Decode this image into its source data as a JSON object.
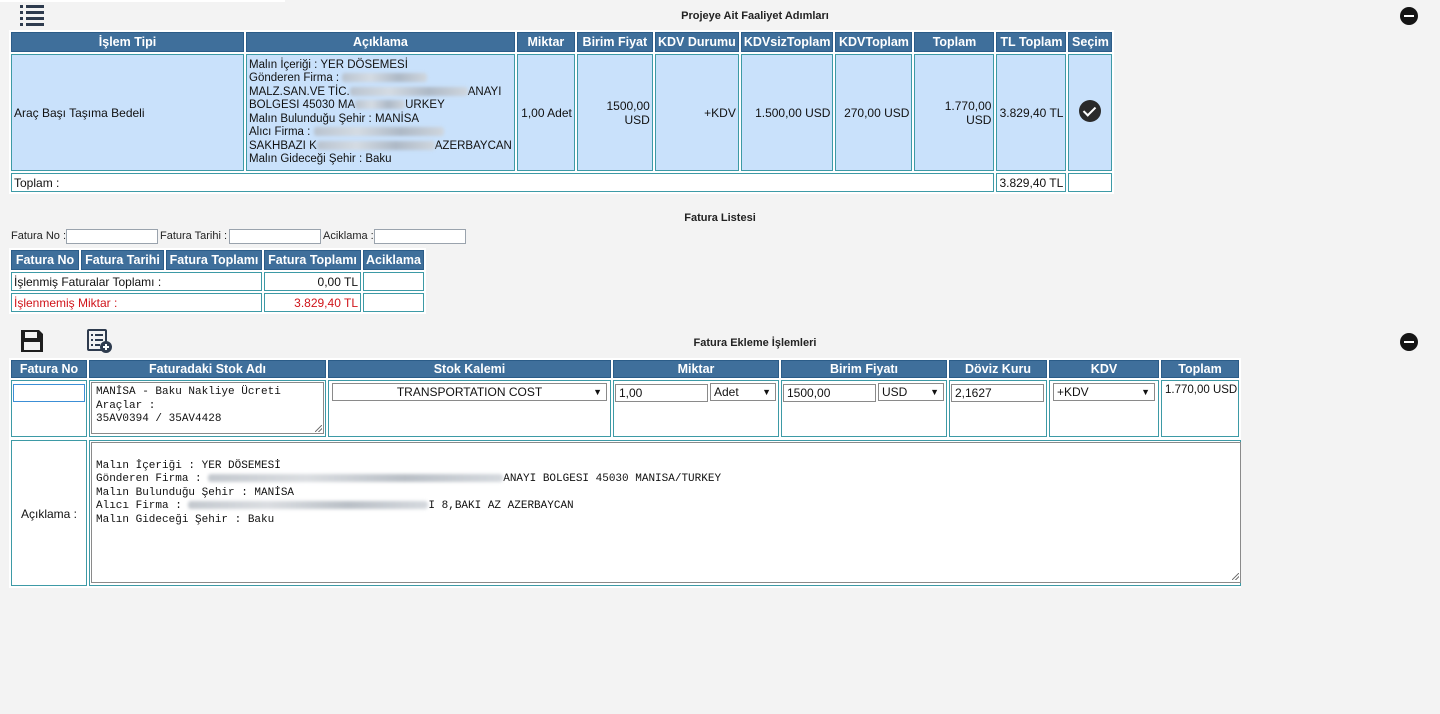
{
  "activity": {
    "title": "Projeye Ait Faaliyet Adımları",
    "headers": [
      "İşlem Tipi",
      "Açıklama",
      "Miktar",
      "Birim Fiyat",
      "KDV Durumu",
      "KDVsizToplam",
      "KDVToplam",
      "Toplam",
      "TL Toplam",
      "Seçim"
    ],
    "row": {
      "islem_tipi": "Araç Başı Taşıma Bedeli",
      "aciklama_lines": [
        "Malın İçeriği : YER DÖSEMESİ",
        "Gönderen Firma :",
        "MALZ.SAN.VE TİC.",
        "BOLGESI 45030 MA",
        "Malın Bulunduğu Şehir : MANİSA",
        "Alıcı Firma :",
        "SAKHBAZI K",
        "Malın Gideceği Şehir : Baku"
      ],
      "aciklama_tail_3": "ANAYI",
      "aciklama_tail_4": "URKEY",
      "aciklama_tail_7": "AZERBAYCAN",
      "miktar": "1,00 Adet",
      "birim_fiyat": "1500,00 USD",
      "kdv_durumu": "+KDV",
      "kdvsiz_toplam": "1.500,00 USD",
      "kdv_toplam": "270,00 USD",
      "toplam": "1.770,00 USD",
      "tl_toplam": "3.829,40 TL"
    },
    "total_label": "Toplam :",
    "total_value": "3.829,40 TL"
  },
  "invoice_list": {
    "title": "Fatura Listesi",
    "filters": {
      "fatura_no": "Fatura No :",
      "fatura_tarihi": "Fatura Tarihi :",
      "aciklama": "Aciklama :"
    },
    "headers": [
      "Fatura No",
      "Fatura Tarihi",
      "Fatura Toplamı",
      "Fatura Toplamı",
      "Aciklama"
    ],
    "processed_label": "İşlenmiş Faturalar Toplamı :",
    "processed_value": "0,00 TL",
    "unprocessed_label": "İşlenmemiş Miktar :",
    "unprocessed_value": "3.829,40 TL"
  },
  "invoice_add": {
    "title": "Fatura Ekleme İşlemleri",
    "headers": [
      "Fatura No",
      "Faturadaki Stok Adı",
      "Stok Kalemi",
      "Miktar",
      "Birim Fiyatı",
      "Döviz Kuru",
      "KDV",
      "Toplam"
    ],
    "fatura_no": "",
    "stok_adi": "MANİSA - Baku Nakliye Ücreti\nAraçlar :\n35AV0394 / 35AV4428",
    "stok_kalemi": "TRANSPORTATION COST",
    "miktar": "1,00",
    "birim": "Adet",
    "birim_fiyati": "1500,00",
    "doviz": "USD",
    "doviz_kuru": "2,1627",
    "kdv": "+KDV",
    "toplam": "1.770,00 USD",
    "aciklama_label": "Açıklama :",
    "aciklama_l1": "Malın İçeriği : YER DÖSEMESİ",
    "aciklama_l2a": "Gönderen Firma : ",
    "aciklama_l2b": "ANAYI BOLGESI 45030 MANISA/TURKEY",
    "aciklama_l3": "Malın Bulunduğu Şehir : MANİSA",
    "aciklama_l4a": "Alıcı Firma : ",
    "aciklama_l4b": "I 8,BAKI AZ AZERBAYCAN",
    "aciklama_l5": "Malın Gideceği Şehir : Baku"
  }
}
